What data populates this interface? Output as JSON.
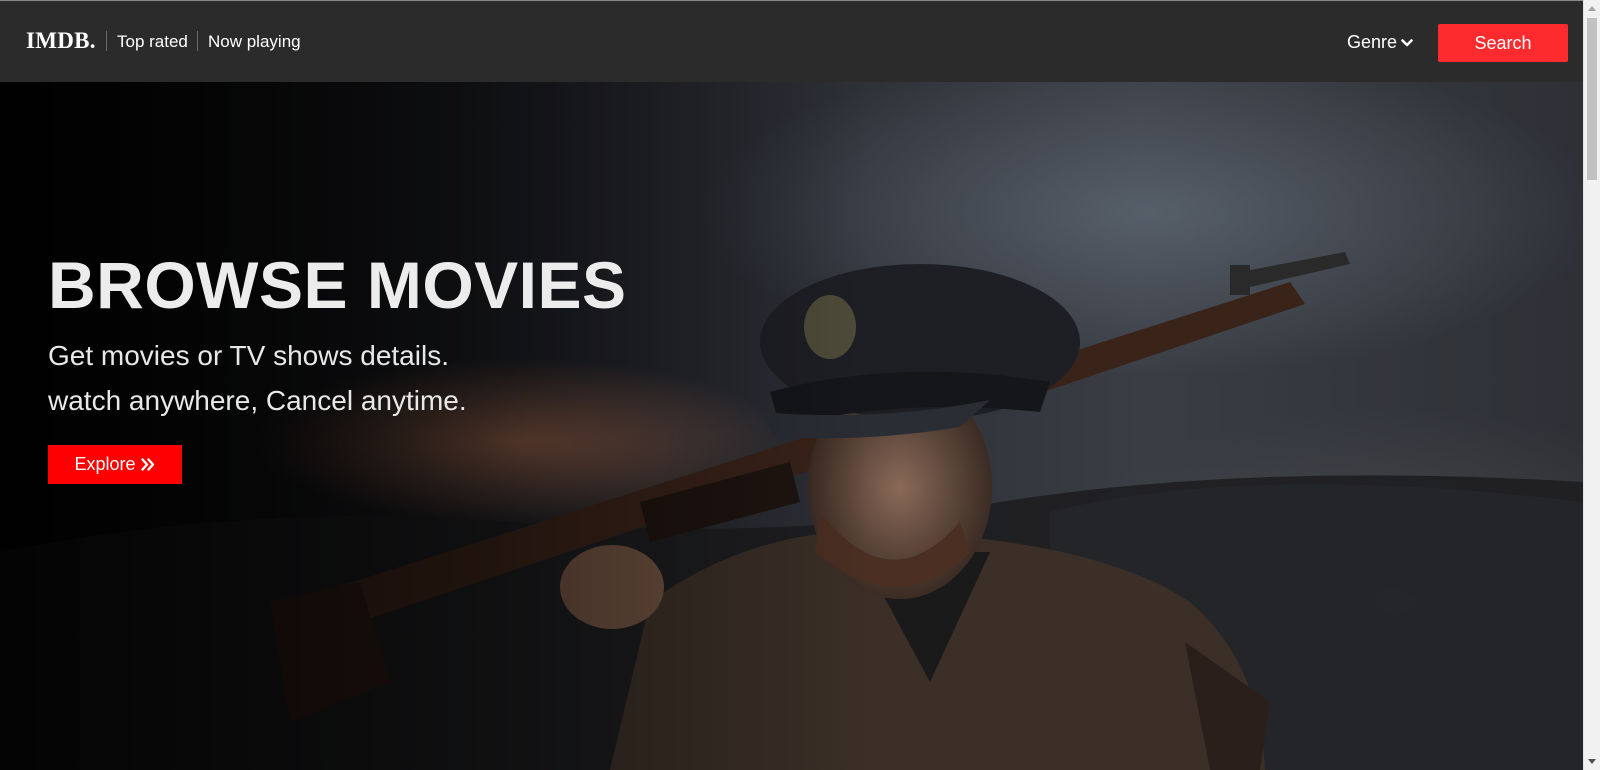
{
  "navbar": {
    "logo": "IMDB.",
    "links": [
      "Top rated",
      "Now playing"
    ],
    "genre_label": "Genre",
    "search_label": "Search"
  },
  "hero": {
    "title": "BROWSE MOVIES",
    "line1": "Get movies or TV shows details.",
    "line2": "watch anywhere, Cancel anytime.",
    "explore_label": "Explore",
    "image_description_icon": "soldier-with-rifle-photo"
  },
  "colors": {
    "navbar_bg": "#2b2b2b",
    "accent_red": "#fe2b2e",
    "explore_red": "#fe0000",
    "text": "#ffffff"
  },
  "icons": {
    "genre_caret": "chevron-down-icon",
    "explore_arrows": "double-chevron-right-icon"
  }
}
